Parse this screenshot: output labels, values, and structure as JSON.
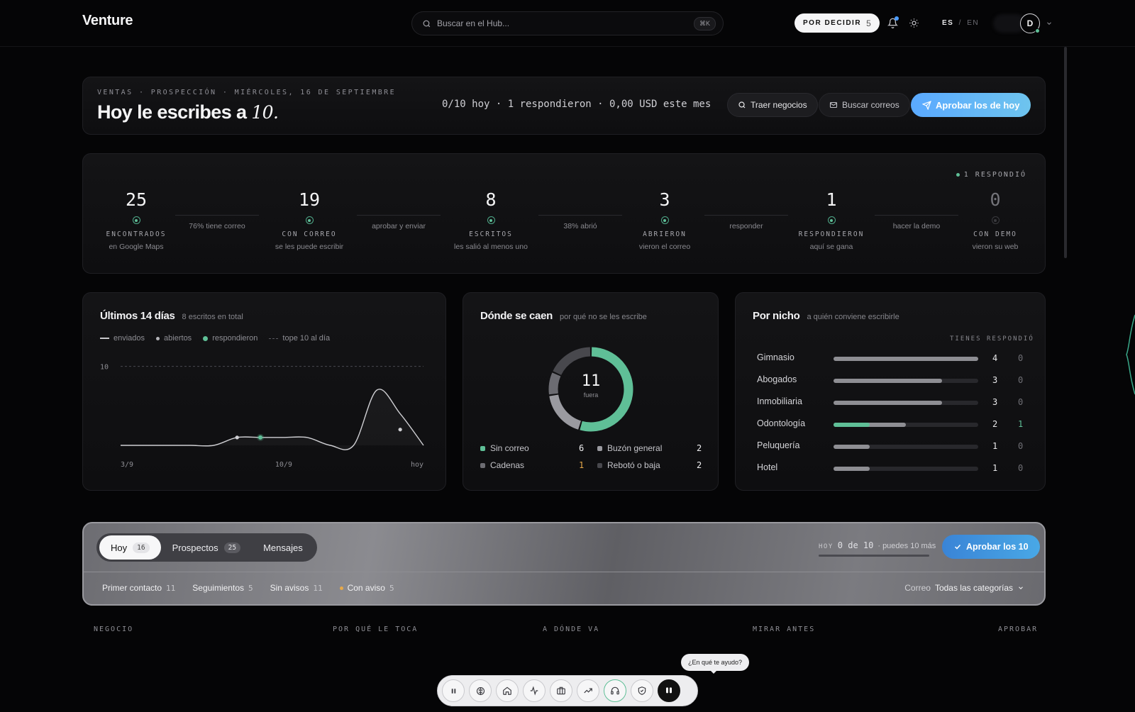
{
  "topbar": {
    "brand": "Venture",
    "search_placeholder": "Buscar en el Hub...",
    "search_shortcut": "⌘K",
    "decide_label": "POR DECIDIR",
    "decide_count": "5",
    "lang_es": "ES",
    "lang_sep": "/",
    "lang_en": "EN",
    "avatar_initial": "D"
  },
  "header": {
    "eyebrow": "VENTAS · PROSPECCIÓN · MIÉRCOLES, 16 DE SEPTIEMBRE",
    "headline_text": "Hoy le escribes a",
    "headline_num": "10.",
    "stats": "0/10 hoy · 1 respondieron · 0,00 USD este mes",
    "btn_traer": "Traer negocios",
    "btn_buscar": "Buscar correos",
    "btn_aprobar": "Aprobar los de hoy"
  },
  "funnel": {
    "responded_badge": "1 RESPONDIÓ",
    "stages": [
      {
        "num": "25",
        "label": "ENCONTRADOS",
        "sub": "en Google Maps"
      },
      {
        "num": "19",
        "label": "CON CORREO",
        "sub": "se les puede escribir"
      },
      {
        "num": "8",
        "label": "ESCRITOS",
        "sub": "les salió al menos uno"
      },
      {
        "num": "3",
        "label": "ABRIERON",
        "sub": "vieron el correo"
      },
      {
        "num": "1",
        "label": "RESPONDIERON",
        "sub": "aquí se gana"
      },
      {
        "num": "0",
        "label": "CON DEMO",
        "sub": "vieron su web"
      }
    ],
    "connectors": [
      "76% tiene correo",
      "aprobar y enviar",
      "38% abrió",
      "responder",
      "hacer la demo"
    ]
  },
  "chart": {
    "title": "Últimos 14 días",
    "subtitle": "8 escritos en total",
    "legend": [
      "enviados",
      "abiertos",
      "respondieron",
      "tope 10 al día"
    ]
  },
  "chart_data": {
    "type": "line",
    "x": [
      "3/9",
      "4/9",
      "5/9",
      "6/9",
      "7/9",
      "8/9",
      "9/9",
      "10/9",
      "11/9",
      "12/9",
      "13/9",
      "14/9",
      "15/9",
      "hoy"
    ],
    "x_tick_labels": [
      "3/9",
      "10/9",
      "hoy"
    ],
    "series": [
      {
        "name": "enviados",
        "values": [
          0,
          0,
          0,
          0,
          0,
          1,
          1,
          1,
          1,
          0,
          0,
          7,
          4,
          0
        ]
      },
      {
        "name": "abiertos",
        "values": [
          null,
          null,
          null,
          null,
          null,
          1,
          null,
          null,
          null,
          null,
          null,
          null,
          2,
          null
        ]
      },
      {
        "name": "respondieron",
        "values": [
          null,
          null,
          null,
          null,
          null,
          null,
          1,
          null,
          null,
          null,
          null,
          null,
          null,
          null
        ]
      }
    ],
    "reference_line": {
      "name": "tope 10 al día",
      "value": 10,
      "label": "10"
    },
    "ylim": [
      0,
      10.5
    ],
    "grid": false
  },
  "drop": {
    "title": "Dónde se caen",
    "subtitle": "por qué no se les escribe",
    "total": "11",
    "total_label": "fuera",
    "items": [
      {
        "label": "Sin correo",
        "value": "6",
        "color": "#5fbf97"
      },
      {
        "label": "Buzón general",
        "value": "2",
        "color": "#9a9aa0"
      },
      {
        "label": "Cadenas",
        "value": "1",
        "color": "#6c6c72",
        "value_color": "#e7a94a"
      },
      {
        "label": "Rebotó o baja",
        "value": "2",
        "color": "#48484d"
      }
    ]
  },
  "niche": {
    "title": "Por nicho",
    "subtitle": "a quién conviene escribirle",
    "col_tienes": "TIENES",
    "col_respondio": "RESPONDIÓ",
    "rows": [
      {
        "name": "Gimnasio",
        "tienes": "4",
        "respondio": "0",
        "frac": 1.0,
        "green": 0
      },
      {
        "name": "Abogados",
        "tienes": "3",
        "respondio": "0",
        "frac": 0.75,
        "green": 0
      },
      {
        "name": "Inmobiliaria",
        "tienes": "3",
        "respondio": "0",
        "frac": 0.75,
        "green": 0
      },
      {
        "name": "Odontología",
        "tienes": "2",
        "respondio": "1",
        "frac": 0.5,
        "green": 0.25
      },
      {
        "name": "Peluquería",
        "tienes": "1",
        "respondio": "0",
        "frac": 0.25,
        "green": 0
      },
      {
        "name": "Hotel",
        "tienes": "1",
        "respondio": "0",
        "frac": 0.25,
        "green": 0
      }
    ]
  },
  "queue": {
    "tabs": [
      {
        "label": "Hoy",
        "count": "16"
      },
      {
        "label": "Prospectos",
        "count": "25"
      },
      {
        "label": "Mensajes",
        "count": ""
      }
    ],
    "hoy_key": "HOY",
    "hoy_value": "0 de 10",
    "hoy_more": "· puedes 10 más",
    "approve_label": "Aprobar los 10",
    "filters": [
      {
        "label": "Primer contacto",
        "count": "11"
      },
      {
        "label": "Seguimientos",
        "count": "5"
      },
      {
        "label": "Sin avisos",
        "count": "11"
      },
      {
        "label": "Con aviso",
        "count": "5"
      }
    ],
    "correo_key": "Correo",
    "correo_value": "Todas las categorías",
    "columns": [
      "NEGOCIO",
      "POR QUÉ LE TOCA",
      "A DÓNDE VA",
      "MIRAR ANTES",
      "APROBAR"
    ]
  },
  "assistant": {
    "tooltip": "¿En qué te ayudo?"
  },
  "dock": {
    "icons": [
      "pause-icon",
      "brain-icon",
      "home-icon",
      "activity-icon",
      "briefcase-icon",
      "trending-up-icon",
      "headphones-icon",
      "shield-check-icon",
      "assistant-icon"
    ]
  }
}
